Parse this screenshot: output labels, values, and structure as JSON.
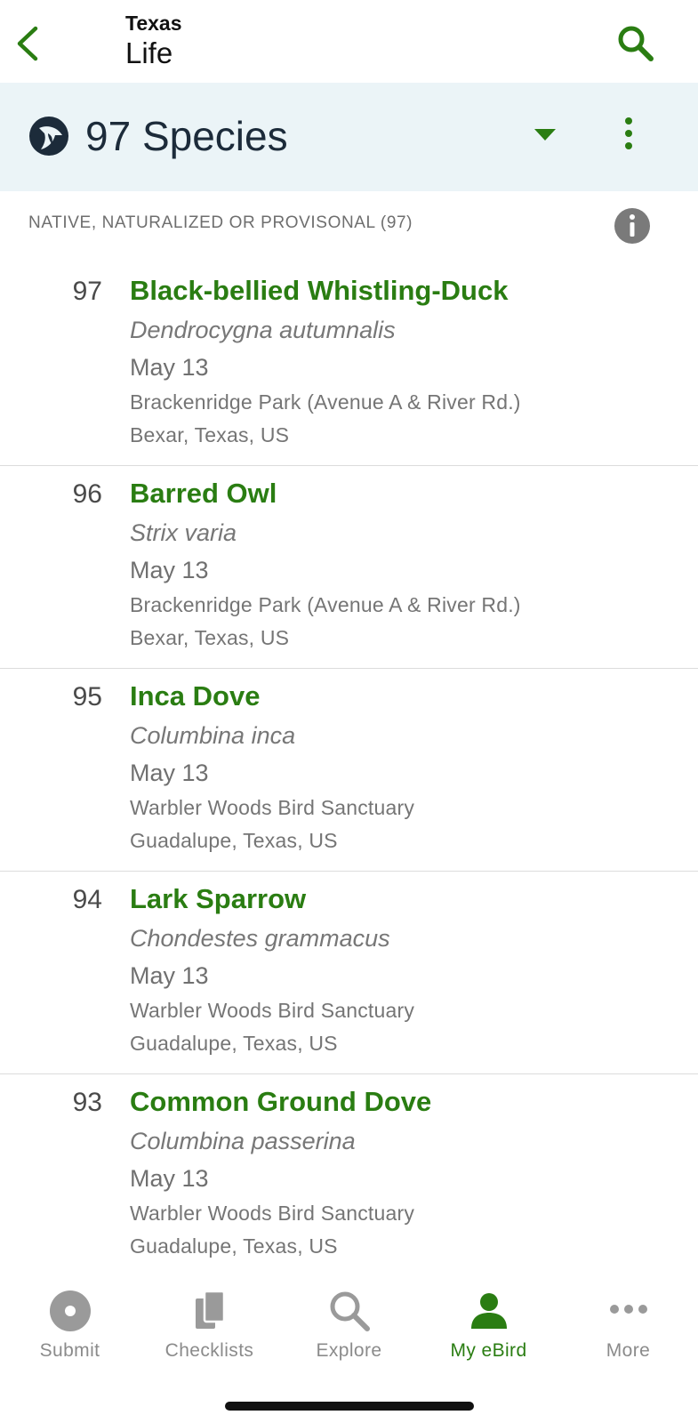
{
  "nav": {
    "region": "Texas",
    "list_type": "Life"
  },
  "summary": {
    "species_count": "97 Species"
  },
  "section": {
    "title": "NATIVE, NATURALIZED OR PROVISONAL (97)"
  },
  "species": [
    {
      "rank": "97",
      "common_name": "Black-bellied Whistling-Duck",
      "scientific_name": "Dendrocygna autumnalis",
      "date": "May 13",
      "location": "Brackenridge Park (Avenue A & River Rd.)",
      "region": "Bexar, Texas, US"
    },
    {
      "rank": "96",
      "common_name": "Barred Owl",
      "scientific_name": "Strix varia",
      "date": "May 13",
      "location": "Brackenridge Park (Avenue A & River Rd.)",
      "region": "Bexar, Texas, US"
    },
    {
      "rank": "95",
      "common_name": "Inca Dove",
      "scientific_name": "Columbina inca",
      "date": "May 13",
      "location": "Warbler Woods Bird Sanctuary",
      "region": "Guadalupe, Texas, US"
    },
    {
      "rank": "94",
      "common_name": "Lark Sparrow",
      "scientific_name": "Chondestes grammacus",
      "date": "May 13",
      "location": "Warbler Woods Bird Sanctuary",
      "region": "Guadalupe, Texas, US"
    },
    {
      "rank": "93",
      "common_name": "Common Ground Dove",
      "scientific_name": "Columbina passerina",
      "date": "May 13",
      "location": "Warbler Woods Bird Sanctuary",
      "region": "Guadalupe, Texas, US"
    }
  ],
  "tabs": [
    {
      "label": "Submit",
      "icon": "submit-icon",
      "active": false
    },
    {
      "label": "Checklists",
      "icon": "checklists-icon",
      "active": false
    },
    {
      "label": "Explore",
      "icon": "explore-icon",
      "active": false
    },
    {
      "label": "My eBird",
      "icon": "person-icon",
      "active": true
    },
    {
      "label": "More",
      "icon": "more-dots-icon",
      "active": false
    }
  ],
  "colors": {
    "accent_green": "#2a7d12",
    "header_band": "#ebf4f7",
    "inactive_tab": "#8b8b8b"
  }
}
